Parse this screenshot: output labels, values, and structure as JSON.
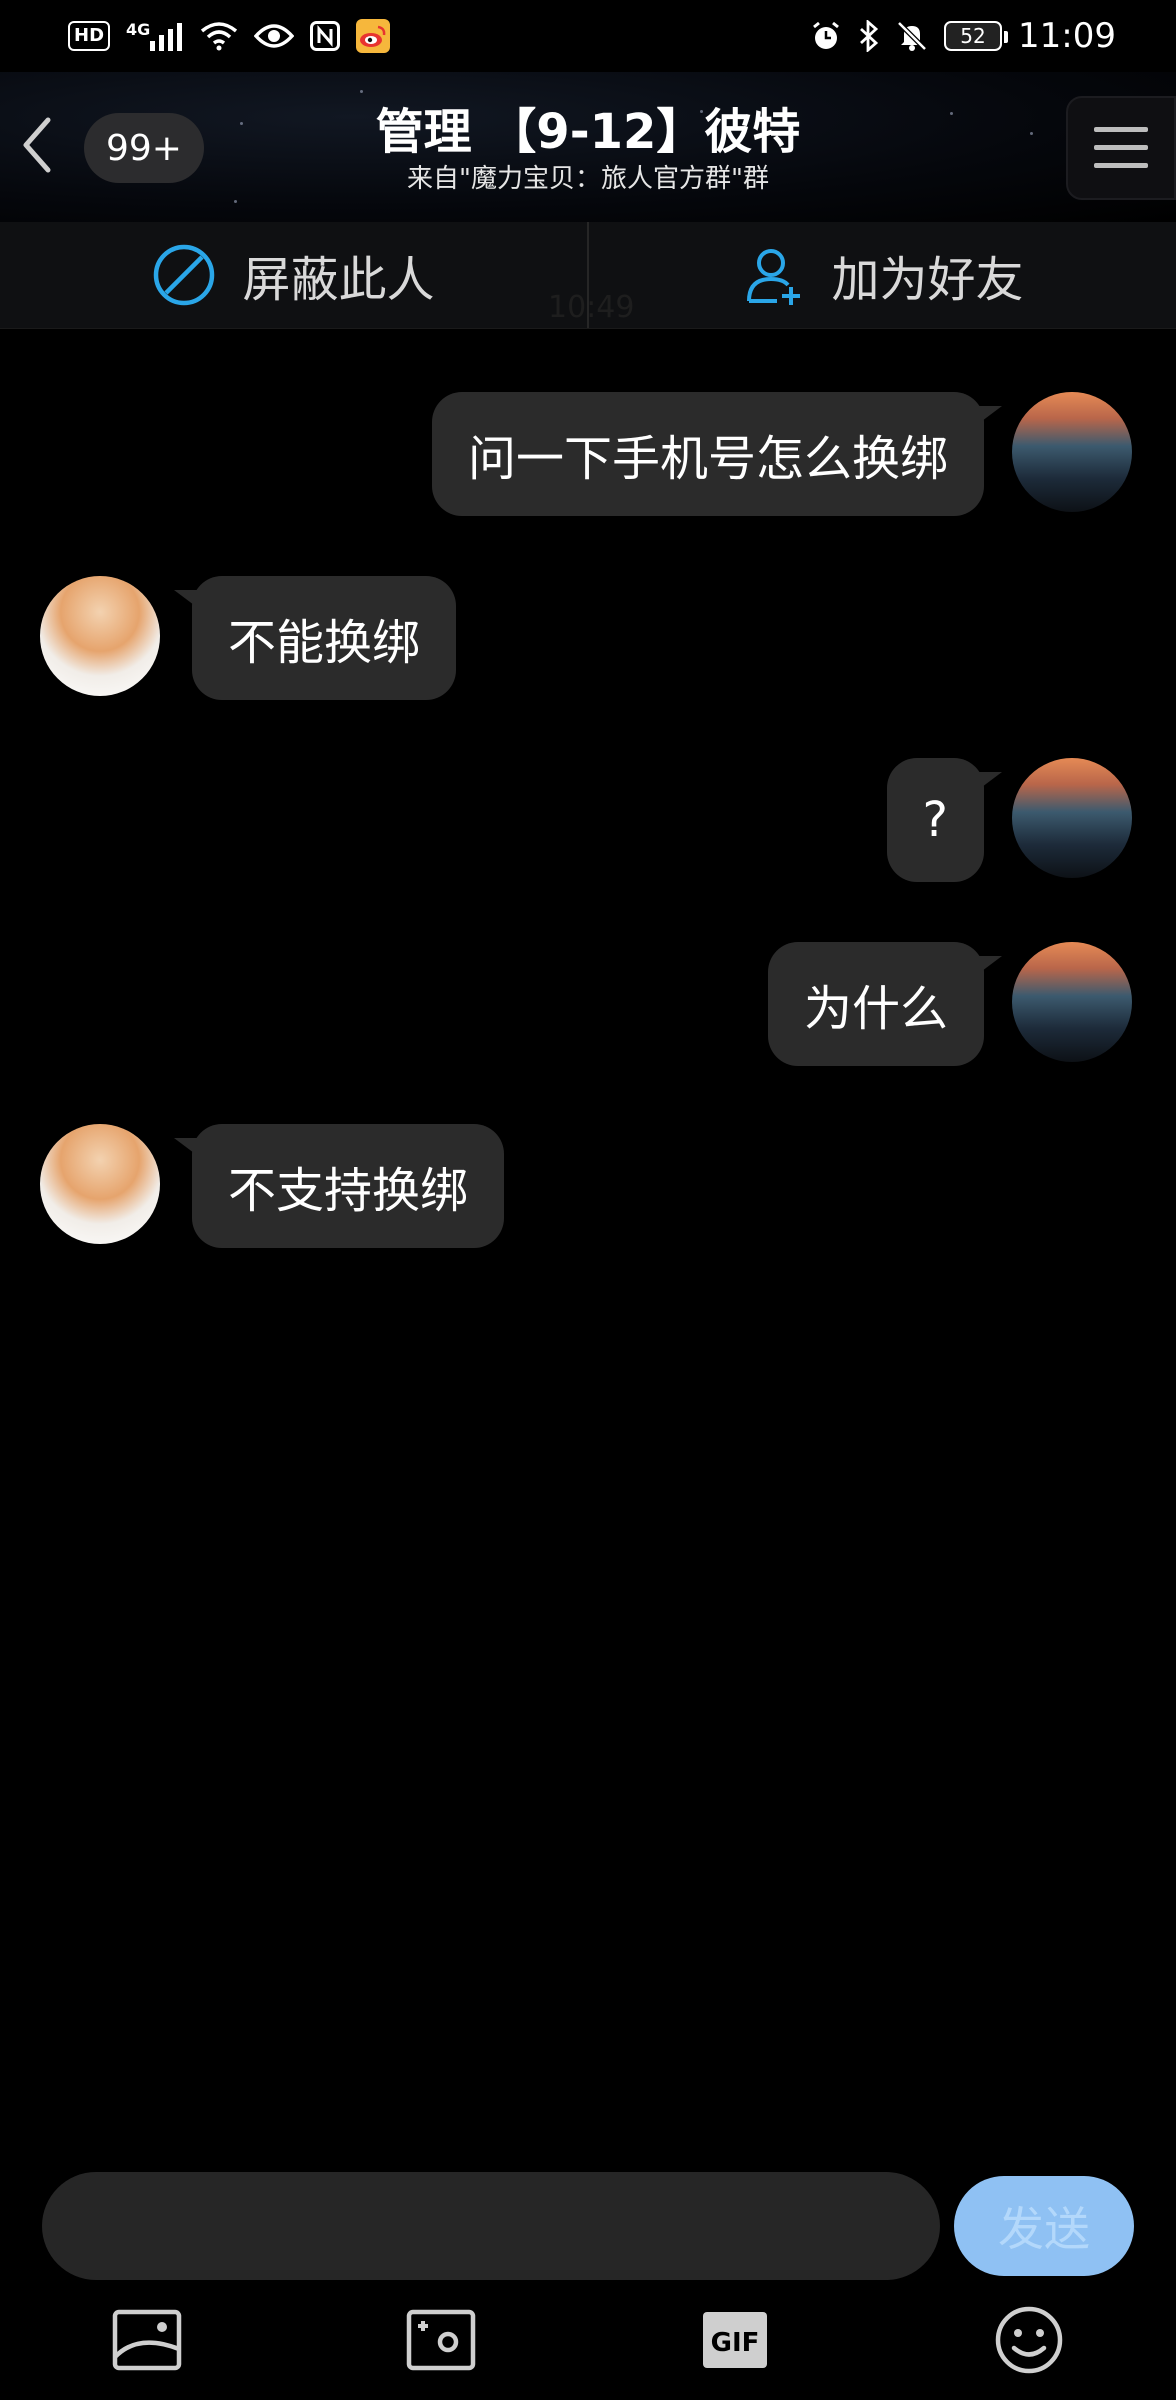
{
  "status_bar": {
    "badge_hd": "HD",
    "network_label": "4G",
    "battery_level": "52",
    "time": "11:09"
  },
  "header": {
    "unread_count": "99+",
    "title": "管理 【9-12】彼特",
    "subtitle": "来自\"魔力宝贝：旅人官方群\"群"
  },
  "action_bar": {
    "block_label": "屏蔽此人",
    "add_friend_label": "加为好友",
    "faint_time": "10:49"
  },
  "messages": [
    {
      "side": "self",
      "text": "问一下手机号怎么换绑"
    },
    {
      "side": "other",
      "text": "不能换绑"
    },
    {
      "side": "self",
      "text": "?"
    },
    {
      "side": "self",
      "text": "为什么"
    },
    {
      "side": "other",
      "text": "不支持换绑"
    }
  ],
  "composer": {
    "input_value": "",
    "send_label": "发送"
  },
  "toolbar": {
    "items": [
      "image-icon",
      "camera-icon",
      "gif-icon",
      "emoji-icon"
    ],
    "gif_label": "GIF"
  },
  "colors": {
    "accent_blue": "#2aa6e8",
    "send_button": "#8fc1f3",
    "bubble": "#2b2b2b"
  }
}
